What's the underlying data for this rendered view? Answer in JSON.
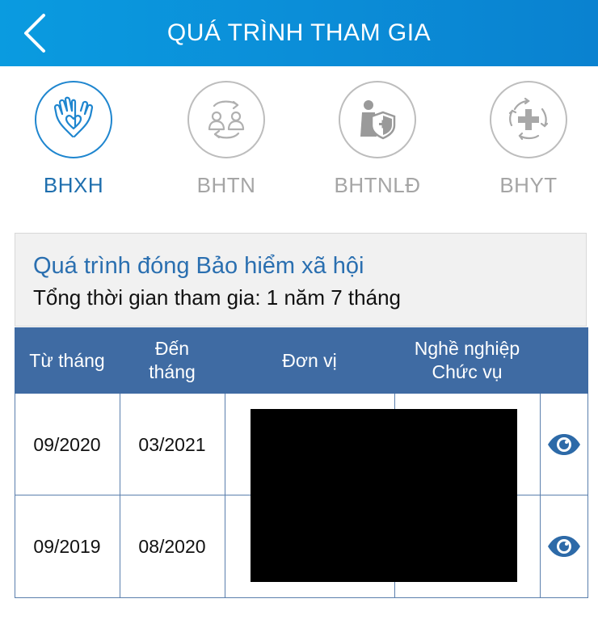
{
  "header": {
    "title": "QUÁ TRÌNH THAM GIA",
    "back_icon": "chevron-left-icon"
  },
  "tabs": [
    {
      "label": "BHXH",
      "icon": "hands-heart-icon",
      "active": true
    },
    {
      "label": "BHTN",
      "icon": "people-exchange-icon",
      "active": false
    },
    {
      "label": "BHTNLĐ",
      "icon": "worker-shield-icon",
      "active": false
    },
    {
      "label": "BHYT",
      "icon": "medical-cross-cycle-icon",
      "active": false
    }
  ],
  "summary": {
    "title": "Quá trình đóng Bảo hiểm xã hội",
    "total": "Tổng thời gian tham gia: 1 năm 7 tháng"
  },
  "table": {
    "headers": {
      "from": "Từ tháng",
      "to_line1": "Đến",
      "to_line2": "tháng",
      "unit": "Đơn vị",
      "job_line1": "Nghề nghiệp",
      "job_line2": "Chức vụ"
    },
    "rows": [
      {
        "from": "09/2020",
        "to": "03/2021",
        "action_icon": "eye-icon"
      },
      {
        "from": "09/2019",
        "to": "08/2020",
        "action_icon": "eye-icon"
      }
    ]
  },
  "colors": {
    "header_bg": "#0a8fd8",
    "active_tab": "#1f6fae",
    "inactive_tab": "#a5a5a5",
    "table_header_bg": "#3f6ba3",
    "eye_icon": "#2d6aa8"
  }
}
